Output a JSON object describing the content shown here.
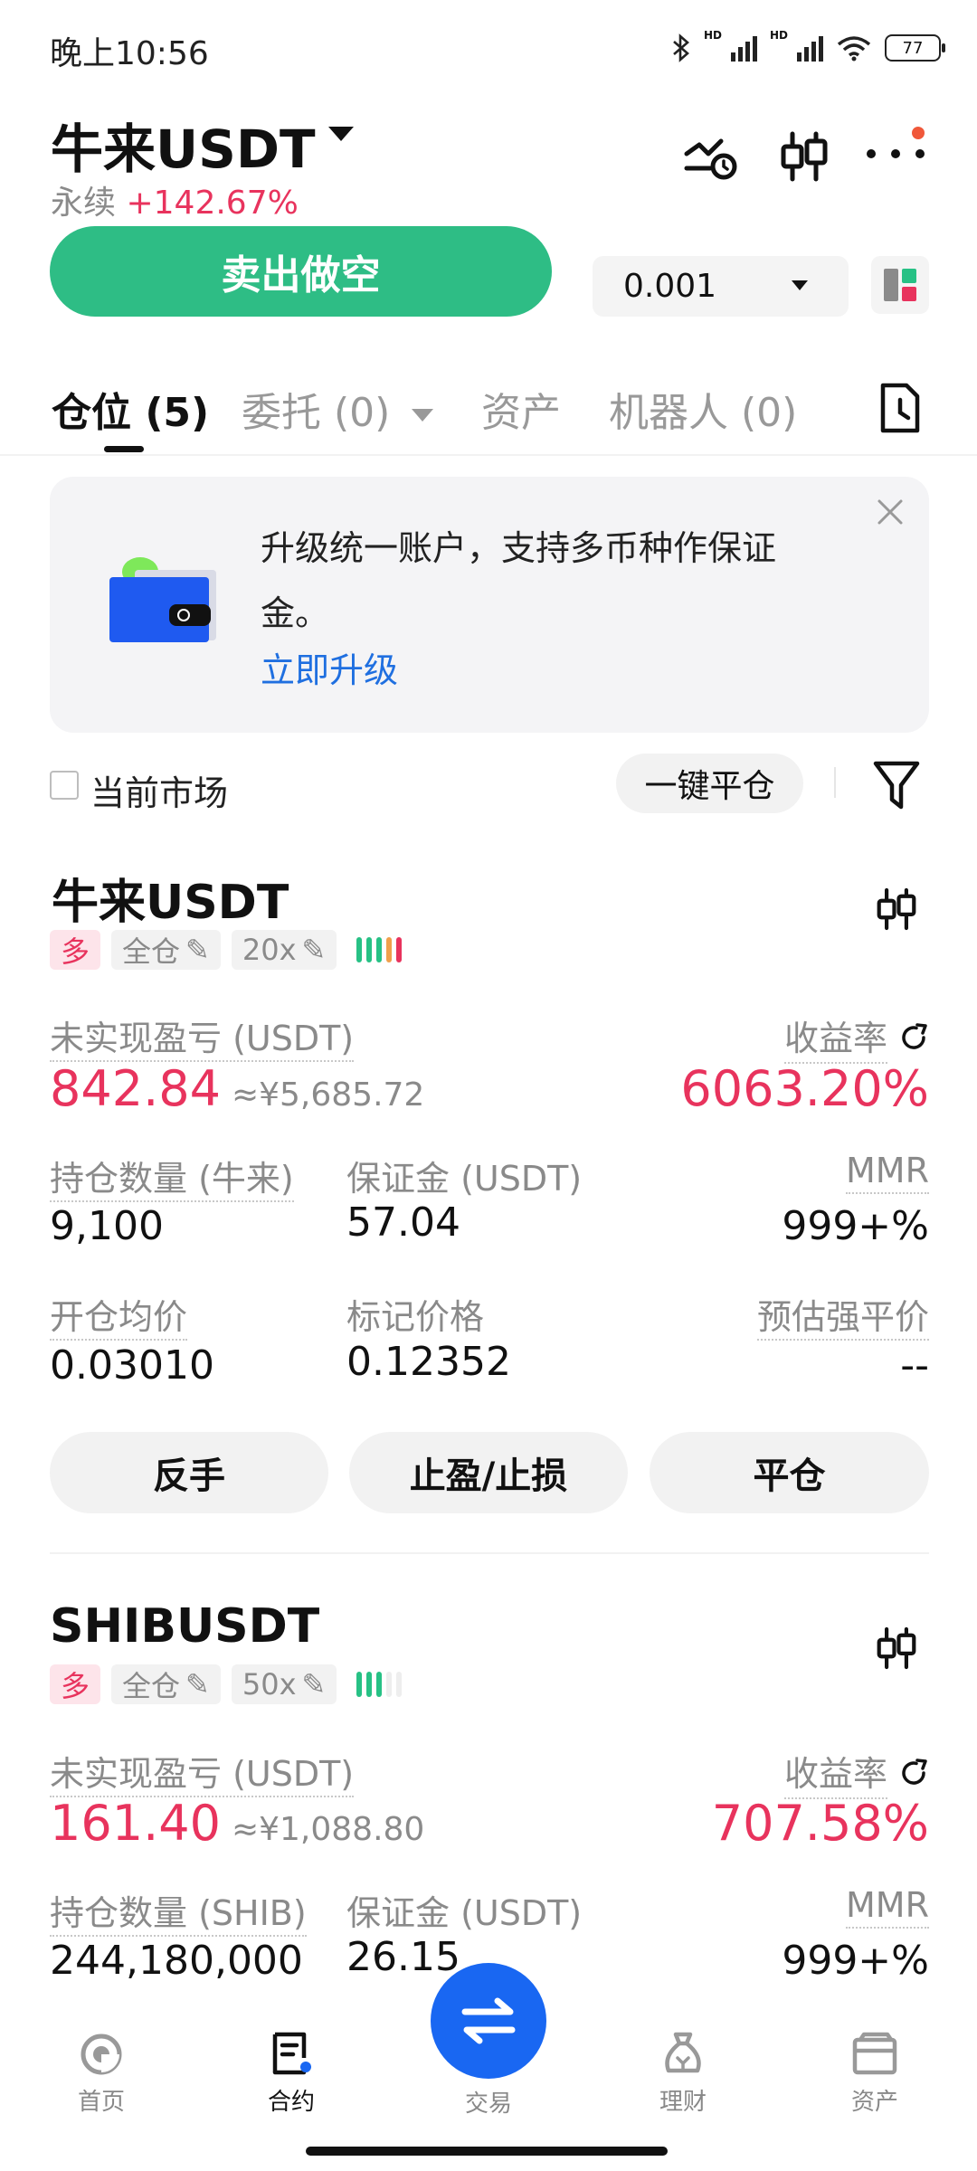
{
  "status_bar": {
    "time": "晚上10:56",
    "battery": "77",
    "hd1": "HD",
    "hd2": "HD"
  },
  "header": {
    "pair": "牛来USDT",
    "contract_type": "永续",
    "change": "+142.67%",
    "icons": [
      "price-alert-icon",
      "candlestick-icon",
      "more-icon"
    ]
  },
  "trade": {
    "sell_label": "卖出做空",
    "quantity": "0.001"
  },
  "tabs": [
    {
      "label": "仓位 (5)"
    },
    {
      "label": "委托 (0)"
    },
    {
      "label": "资产"
    },
    {
      "label": "机器人 (0)"
    }
  ],
  "banner": {
    "text": "升级统一账户，支持多币种作保证金。",
    "link": "立即升级"
  },
  "filter": {
    "current_market": "当前市场",
    "close_all": "一键平仓"
  },
  "positions": [
    {
      "symbol": "牛来USDT",
      "side": "多",
      "margin_mode": "全仓",
      "leverage": "20x",
      "pnl_label": "未实现盈亏 (USDT)",
      "pnl": "842.84",
      "pnl_cny": "≈¥5,685.72",
      "roe_label": "收益率",
      "roe": "6063.20%",
      "size_label": "持仓数量 (牛来)",
      "size": "9,100",
      "margin_label": "保证金 (USDT)",
      "margin": "57.04",
      "mmr_label": "MMR",
      "mmr": "999+%",
      "entry_label": "开仓均价",
      "entry": "0.03010",
      "mark_label": "标记价格",
      "mark": "0.12352",
      "liq_label": "预估强平价",
      "liq": "--",
      "btn_reverse": "反手",
      "btn_tpsl": "止盈/止损",
      "btn_close": "平仓"
    },
    {
      "symbol": "SHIBUSDT",
      "side": "多",
      "margin_mode": "全仓",
      "leverage": "50x",
      "pnl_label": "未实现盈亏 (USDT)",
      "pnl": "161.40",
      "pnl_cny": "≈¥1,088.80",
      "roe_label": "收益率",
      "roe": "707.58%",
      "size_label": "持仓数量 (SHIB)",
      "size": "244,180,000",
      "margin_label": "保证金 (USDT)",
      "margin": "26.15",
      "mmr_label": "MMR",
      "mmr": "999+%"
    }
  ],
  "bottom_nav": [
    {
      "label": "首页",
      "icon": "home-icon"
    },
    {
      "label": "合约",
      "icon": "contract-icon"
    },
    {
      "label": "交易",
      "icon": "swap-icon"
    },
    {
      "label": "理财",
      "icon": "finance-icon"
    },
    {
      "label": "资产",
      "icon": "wallet-icon"
    }
  ],
  "colors": {
    "up_red": "#e8335d",
    "sell_green": "#2ebd85",
    "accent_blue": "#1967f2",
    "link_blue": "#1f6fe0"
  }
}
